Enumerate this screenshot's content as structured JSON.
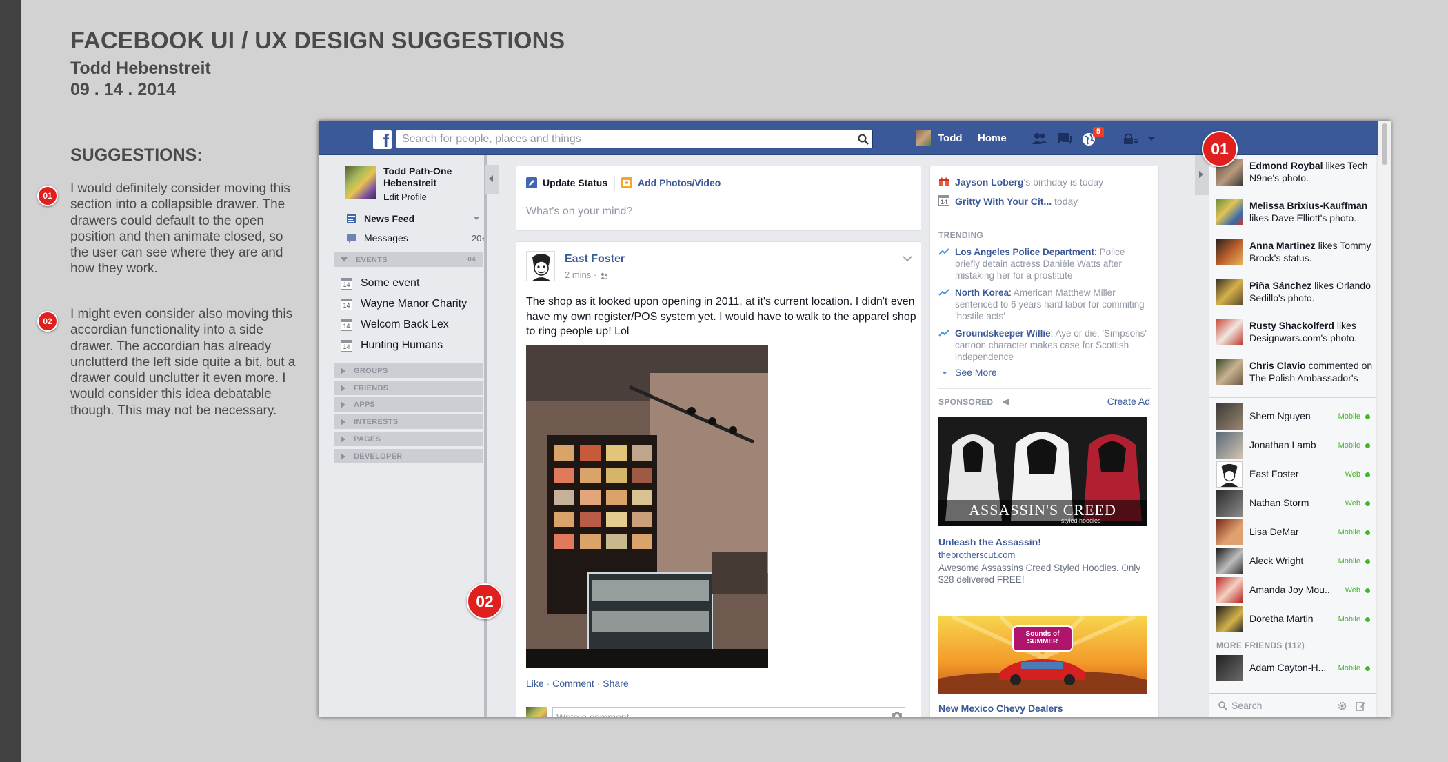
{
  "presentation": {
    "title": "FACEBOOK UI / UX DESIGN SUGGESTIONS",
    "author": "Todd Hebenstreit",
    "date": "09 . 14 . 2014",
    "suggestions_heading": "SUGGESTIONS:",
    "suggestions": [
      {
        "badge": "01",
        "text": "I would definitely consider moving this section into a collapsible drawer. The drawers could default to the open position and then animate closed, so the user can see where they are and how they work."
      },
      {
        "badge": "02",
        "text": "I might even consider also moving this accordian functionality into a side drawer. The accordian has already unclutterd the left side quite a bit, but a drawer could unclutter it even more. I would consider this idea debatable though. This may not be necessary."
      }
    ],
    "callouts": [
      "01",
      "02"
    ]
  },
  "topbar": {
    "logo": "f",
    "search_placeholder": "Search for people, places and things",
    "user": "Todd",
    "home": "Home",
    "notification_count": "5"
  },
  "left_nav": {
    "profile_name": "Todd Path-One Hebenstreit",
    "edit_profile": "Edit Profile",
    "news_feed": "News Feed",
    "messages": "Messages",
    "messages_count": "20+",
    "events_label": "EVENTS",
    "events_count": "04",
    "events": [
      "Some event",
      "Wayne Manor Charity",
      "Welcom Back Lex",
      "Hunting Humans"
    ],
    "calendar_day": "14",
    "sections": [
      "GROUPS",
      "FRIENDS",
      "APPS",
      "INTERESTS",
      "PAGES",
      "DEVELOPER"
    ]
  },
  "composer": {
    "update_status": "Update Status",
    "add_photos": "Add Photos/Video",
    "placeholder": "What's on your mind?"
  },
  "post": {
    "author": "East Foster",
    "time": "2 mins ·",
    "text": "The shop as it looked upon opening in 2011, at it's current location. I didn't even have my own register/POS system yet. I would have to walk to the apparel shop to ring people up! Lol",
    "like": "Like",
    "comment": "Comment",
    "share": "Share",
    "comment_placeholder": "Write a comment..."
  },
  "right_column": {
    "birthday_name": "Jayson Loberg",
    "birthday_suffix": "'s birthday is today",
    "event_name": "Gritty With Your Cit...",
    "event_suffix": " today",
    "trending_label": "TRENDING",
    "trending": [
      {
        "topic": "Los Angeles Police Department",
        "desc": "Police briefly detain actress Danièle Watts after mistaking her for a prostitute"
      },
      {
        "topic": "North Korea",
        "desc": "American Matthew Miller sentenced to 6 years hard labor for commiting 'hostile acts'"
      },
      {
        "topic": "Groundskeeper Willie",
        "desc": "Aye or die: 'Simpsons' cartoon character makes case for Scottish independence"
      }
    ],
    "see_more": "See More",
    "sponsored_label": "SPONSORED",
    "create_ad": "Create Ad",
    "ad1_title": "Unleash the Assassin!",
    "ad1_url": "thebrotherscut.com",
    "ad1_desc": "Awesome Assassins Creed Styled Hoodies. Only $28 delivered FREE!",
    "ad1_logo": "ASSASSIN'S CREED",
    "ad1_logo_sub": "styled hoodies",
    "ad2_logo": "Sounds of SUMMER",
    "ad2_title": "New Mexico Chevy Dealers"
  },
  "ticker": [
    {
      "name": "Edmond Roybal",
      "action": " likes Tech N9ne's photo."
    },
    {
      "name": "Melissa Brixius-Kauffman",
      "action": " likes Dave Elliott's photo."
    },
    {
      "name": "Anna Martinez",
      "action": " likes Tommy Brock's status."
    },
    {
      "name": "Piña Sánchez",
      "action": " likes Orlando Sedillo's photo."
    },
    {
      "name": "Rusty Shackolferd",
      "action": " likes Designwars.com's photo."
    },
    {
      "name": "Chris Clavio",
      "action": " commented on The Polish Ambassador's status."
    }
  ],
  "chat": {
    "friends": [
      {
        "name": "Shem Nguyen",
        "status": "Mobile"
      },
      {
        "name": "Jonathan Lamb",
        "status": "Mobile"
      },
      {
        "name": "East Foster",
        "status": "Web"
      },
      {
        "name": "Nathan Storm",
        "status": "Web"
      },
      {
        "name": "Lisa DeMar",
        "status": "Mobile"
      },
      {
        "name": "Aleck Wright",
        "status": "Mobile"
      },
      {
        "name": "Amanda Joy Mou...",
        "status": "Web"
      },
      {
        "name": "Doretha Martin",
        "status": "Mobile"
      }
    ],
    "more_friends": "MORE FRIENDS (112)",
    "more": [
      {
        "name": "Adam Cayton-H...",
        "status": "Mobile"
      }
    ],
    "search_placeholder": "Search"
  },
  "colors": {
    "brand": "#3b5998",
    "badge_red": "#e01f1f",
    "online_green": "#42b72a"
  }
}
